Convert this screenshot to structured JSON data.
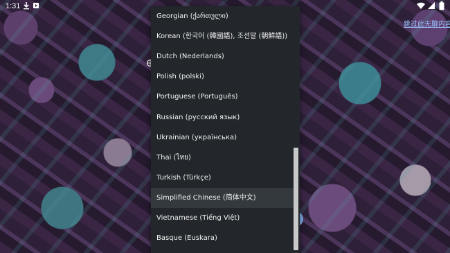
{
  "status_bar": {
    "time": "1:31",
    "icons": [
      "download-icon",
      "notification-icon",
      "wifi-icon",
      "signal-icon",
      "battery-icon"
    ]
  },
  "skip_link": "跳过此无聊内容",
  "language_menu": {
    "selected_index": 9,
    "items": [
      "Georgian (ქართული)",
      "Korean (한국어 (韓國語), 조선말 (朝鮮語))",
      "Dutch (Nederlands)",
      "Polish (polski)",
      "Portuguese (Português)",
      "Russian (русский язык)",
      "Ukrainian (українська)",
      "Thai (ไทย)",
      "Turkish (Türkçe)",
      "Simplified Chinese (简体中文)",
      "Vietnamese (Tiếng Việt)",
      "Basque (Euskara)"
    ]
  },
  "colors": {
    "menu_background": "#23272b",
    "selected_row": "#34393e",
    "link": "#9ec3ff"
  }
}
